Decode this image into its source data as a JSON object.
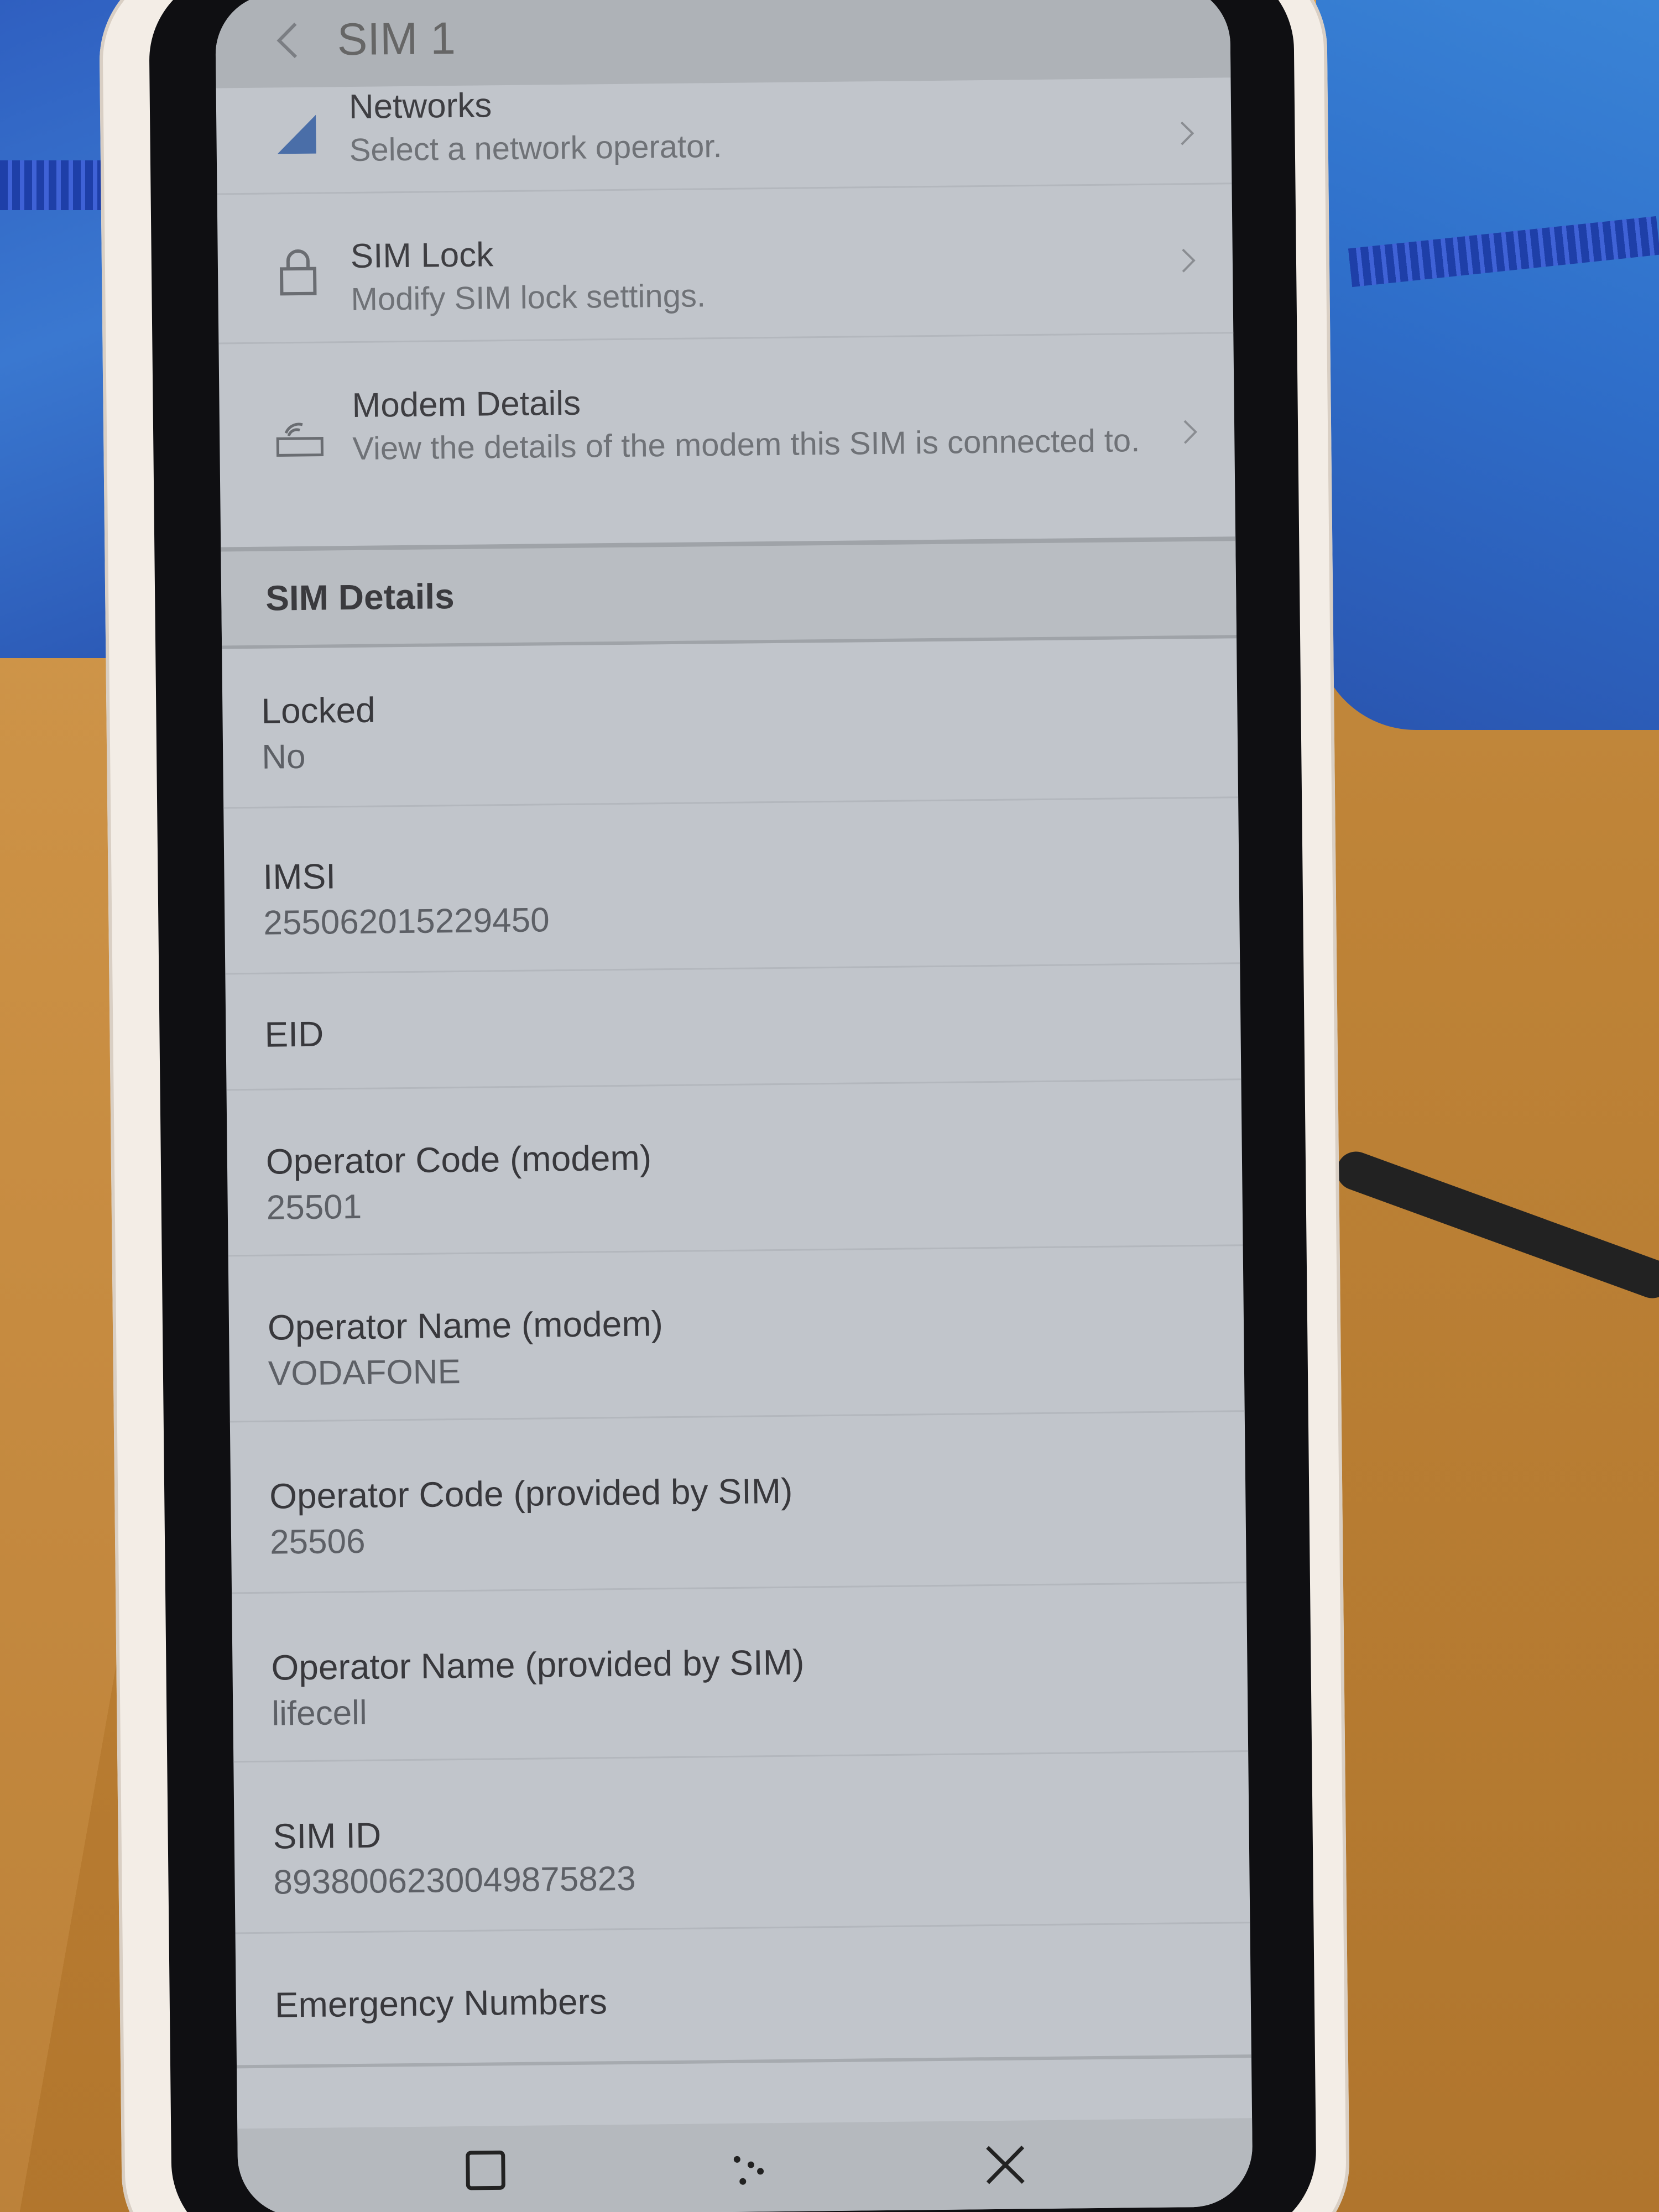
{
  "header": {
    "title": "SIM 1"
  },
  "settings": [
    {
      "label": "Networks",
      "sub": "Select a network operator.",
      "icon": "signal-icon"
    },
    {
      "label": "SIM Lock",
      "sub": "Modify SIM lock settings.",
      "icon": "lock-icon"
    },
    {
      "label": "Modem Details",
      "sub": "View the details of the modem this SIM is connected to.",
      "icon": "modem-icon"
    }
  ],
  "sim_details": {
    "header": "SIM Details",
    "items": [
      {
        "label": "Locked",
        "value": "No"
      },
      {
        "label": "IMSI",
        "value": "255062015229450"
      },
      {
        "label": "EID",
        "value": ""
      },
      {
        "label": "Operator Code (modem)",
        "value": "25501"
      },
      {
        "label": "Operator Name (modem)",
        "value": "VODAFONE"
      },
      {
        "label": "Operator Code (provided by SIM)",
        "value": "25506"
      },
      {
        "label": "Operator Name (provided by SIM)",
        "value": "lifecell"
      },
      {
        "label": "SIM ID",
        "value": "8938006230049875823"
      },
      {
        "label": "Emergency Numbers",
        "value": ""
      }
    ]
  },
  "navbar": {
    "icons": [
      "overview-icon",
      "drag-handle-icon",
      "close-icon"
    ]
  }
}
